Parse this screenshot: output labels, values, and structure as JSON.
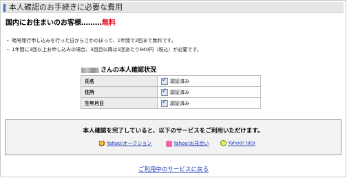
{
  "header": {
    "title": "本人確認のお手続きに必要な費用"
  },
  "headline": {
    "prefix": "国内にお住まいのお客様………",
    "emphasis": "無料"
  },
  "notes": [
    "・ 暗号発行申し込みを行った日からさかのぼって、1年間で2回まで無料です。",
    "・ 1年間に3回以上お申し込みの場合、3回目以降は1回あたり840円（税込）が必要です。"
  ],
  "status": {
    "title_suffix": "さんの本人確認状況",
    "rows": [
      {
        "label": "氏名",
        "value": "認証済み"
      },
      {
        "label": "住所",
        "value": "認証済み"
      },
      {
        "label": "生年月日",
        "value": "認証済み"
      }
    ]
  },
  "services": {
    "message": "本人確認を完了していると、以下のサービスをご利用いただけます。",
    "items": [
      {
        "label": "Yahoo!オークション",
        "icon": "auction-icon"
      },
      {
        "label": "Yahoo!お見合い",
        "icon": "omiai-icon"
      },
      {
        "label": "Yahoo! toto",
        "icon": "toto-icon"
      }
    ]
  },
  "footer": {
    "return_link": "ご利用中のサービスに戻る"
  },
  "colors": {
    "accent": "#3f6fb8",
    "emphasis": "#e60012",
    "link": "#1a37b8"
  }
}
